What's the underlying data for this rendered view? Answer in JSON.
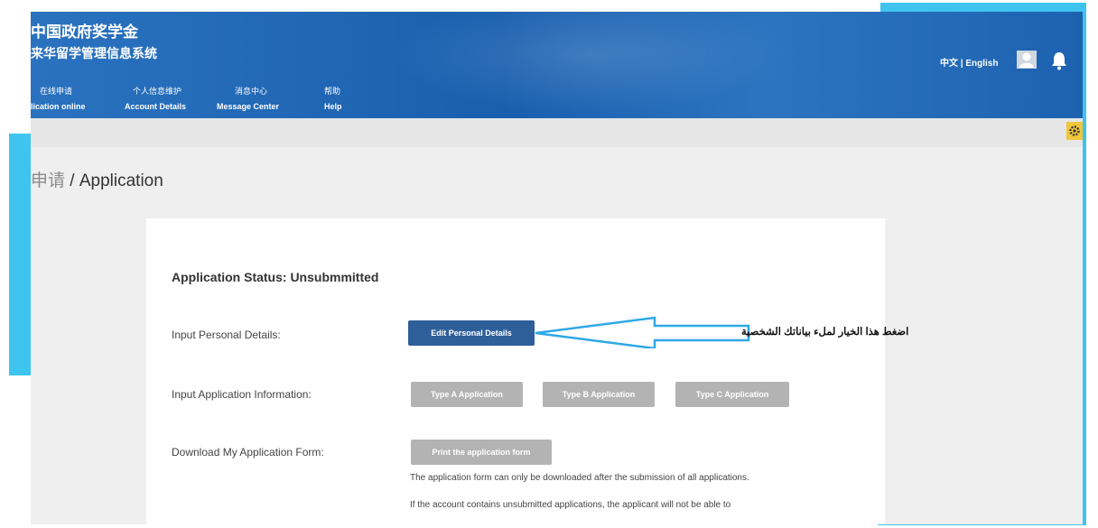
{
  "header": {
    "logo_line1": "中国政府奖学金",
    "logo_line2": "来华留学管理信息系统",
    "language_switch": "中文 | English",
    "user_icon": "user-icon",
    "bell_icon": "bell-icon",
    "color": "#1f64b2"
  },
  "nav": {
    "items": [
      {
        "cn": "在线申请",
        "en": "lication online"
      },
      {
        "cn": "个人信息维护",
        "en": "Account Details"
      },
      {
        "cn": "消息中心",
        "en": "Message Center"
      },
      {
        "cn": "帮助",
        "en": "Help"
      }
    ]
  },
  "toolbar": {
    "settings_icon": "gear-icon",
    "settings_color": "#f0c63a"
  },
  "page": {
    "title_cn": "申请",
    "title_separator": " / ",
    "title_en": "Application"
  },
  "form": {
    "status": "Application Status: Unsubmmitted",
    "personal_label": "Input Personal Details:",
    "edit_personal_button": "Edit Personal Details",
    "application_label": "Input Application Information:",
    "type_a_button": "Type A Application",
    "type_b_button": "Type B Application",
    "type_c_button": "Type C Application",
    "download_label": "Download My Application Form:",
    "print_button": "Print the application form",
    "note1": "The application form can only be downloaded after the submission of all applications.",
    "note2": "If the account contains unsubmitted applications, the applicant will not be able to",
    "primary_color": "#2f5f9a",
    "disabled_color": "#b3b3b3"
  },
  "annotation": {
    "text": "اضغط هذا الخيار لملء بياناتك الشخصية",
    "arrow_color": "#2fa8e6"
  },
  "decoration": {
    "frame_color": "#3fc4ef"
  }
}
